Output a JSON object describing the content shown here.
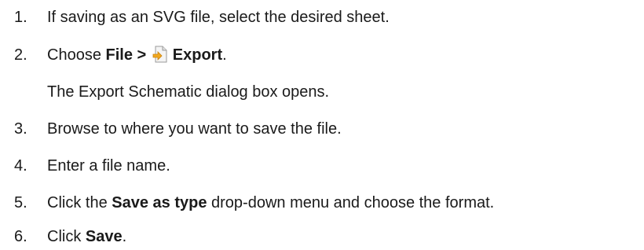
{
  "steps": [
    {
      "number": "1.",
      "text": "If saving as an SVG file, select the desired sheet."
    },
    {
      "number": "2.",
      "prefix": "Choose ",
      "menu_path": "File >",
      "icon": "export-file-icon",
      "menu_item": "Export",
      "suffix": ".",
      "note": "The Export Schematic dialog box opens."
    },
    {
      "number": "3.",
      "text": "Browse to where you want to save the file."
    },
    {
      "number": "4.",
      "text": "Enter a file name."
    },
    {
      "number": "5.",
      "prefix": "Click the ",
      "bold": "Save as type",
      "suffix": " drop-down menu and choose the format."
    },
    {
      "number": "6.",
      "prefix": "Click ",
      "bold": "Save",
      "suffix": "."
    }
  ],
  "colors": {
    "text": "#1a1a1a",
    "icon_page": "#f4f4f4",
    "icon_arrow": "#f2a81d"
  }
}
